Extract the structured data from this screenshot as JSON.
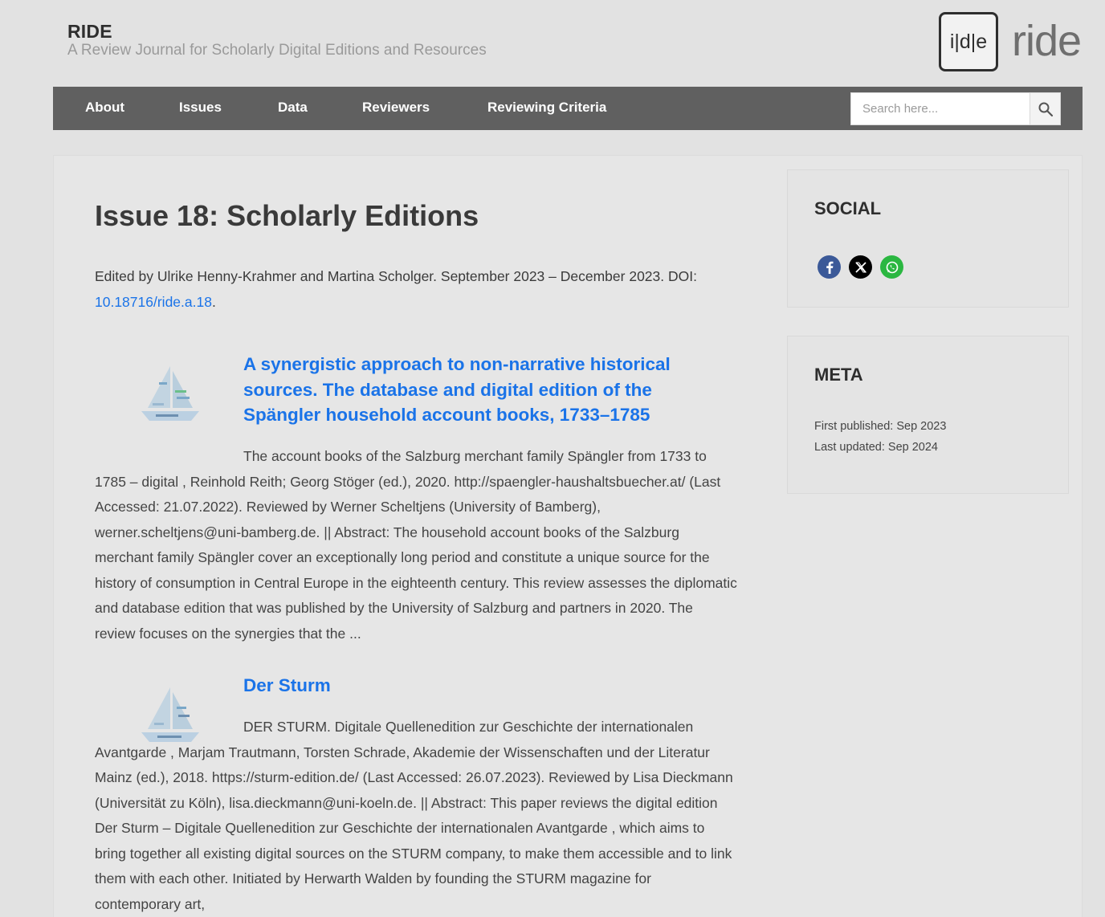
{
  "header": {
    "site_title": "RIDE",
    "tagline": "A Review Journal for Scholarly Digital Editions and Resources",
    "logo_box_text": "i|d|e",
    "logo_word": "ride"
  },
  "nav": {
    "items": [
      "About",
      "Issues",
      "Data",
      "Reviewers",
      "Reviewing Criteria"
    ],
    "search_placeholder": "Search here...",
    "search_icon": "search-icon"
  },
  "main": {
    "title": "Issue 18: Scholarly Editions",
    "intro_text": "Edited by Ulrike Henny-Krahmer and Martina Scholger. September 2023 – December 2023. DOI: ",
    "doi_link": "10.18716/ride.a.18",
    "intro_end": ".",
    "articles": [
      {
        "title": "A synergistic approach to non-narrative historical sources. The database and digital edition of the Spängler household account books, 1733–1785",
        "excerpt": "The account books of the Salzburg merchant family Spängler from 1733 to 1785 – digital , Reinhold Reith; Georg Stöger (ed.), 2020. http://spaengler-haushaltsbuecher.at/ (Last Accessed: 21.07.2022). Reviewed by Werner Scheltjens (University of Bamberg), werner.scheltjens@uni-bamberg.de. || Abstract: The household account books of the Salzburg merchant family Spängler cover an exceptionally long period and constitute a unique source for the history of consumption in Central Europe in the eighteenth century. This review assesses the diplomatic and database edition that was published by the University of Salzburg and partners in 2020. The review focuses on the synergies that the ...",
        "thumbnail_icon": "word-cloud-ship-icon"
      },
      {
        "title": "Der Sturm",
        "excerpt": "DER STURM. Digitale Quellenedition zur Geschichte der internationalen Avantgarde , Marjam Trautmann, Torsten Schrade, Akademie der Wissenschaften und der Literatur Mainz (ed.), 2018. https://sturm-edition.de/ (Last Accessed: 26.07.2023). Reviewed by Lisa Dieckmann (Universität zu Köln), lisa.dieckmann@uni-koeln.de. || Abstract: This paper reviews the digital edition Der Sturm – Digitale Quellenedition zur Geschichte der internationalen Avantgarde , which aims to bring together all existing digital sources on the STURM company, to make them accessible and to link them with each other. Initiated by Herwarth Walden by founding the STURM magazine for contemporary art,",
        "thumbnail_icon": "word-cloud-ship-icon"
      }
    ]
  },
  "sidebar": {
    "social": {
      "title": "SOCIAL",
      "icons": [
        "facebook-icon",
        "x-icon",
        "whatsapp-icon"
      ]
    },
    "meta": {
      "title": "META",
      "first_published": "First published: Sep 2023",
      "last_updated": "Last updated: Sep 2024"
    }
  },
  "colors": {
    "nav_bg": "#606060",
    "link": "#1a73e8",
    "page_bg": "#e2e2e2",
    "facebook": "#3b5998",
    "x": "#000000",
    "whatsapp": "#2bb741"
  }
}
